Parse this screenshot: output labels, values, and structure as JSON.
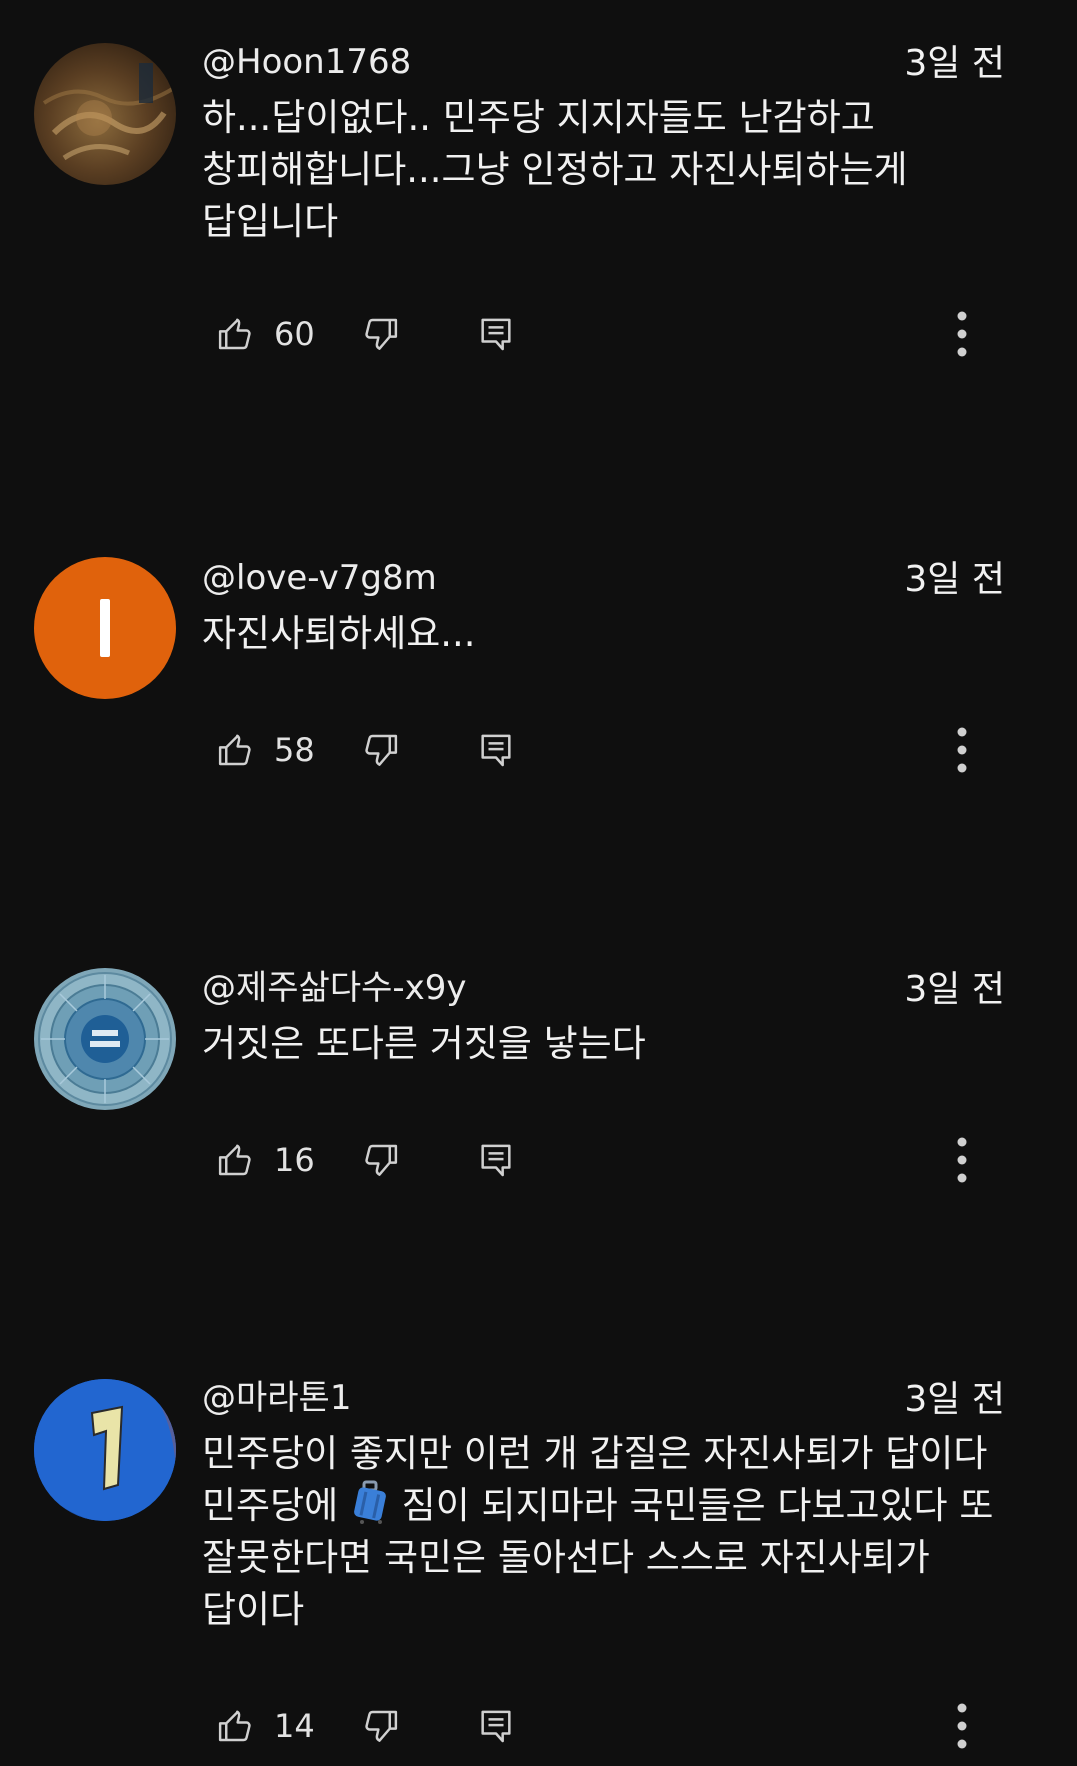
{
  "comments": [
    {
      "author": "@Hoon1768",
      "time": "3일 전",
      "text": "하...답이없다.. 민주당 지지자들도 난감하고 창피해합니다...그냥 인정하고 자진사퇴하는게 답입니다",
      "likes": "60",
      "avatar": "photo-avatar"
    },
    {
      "author": "@love-v7g8m",
      "time": "3일 전",
      "text": "자진사퇴하세요...",
      "likes": "58",
      "avatar": "letter-avatar",
      "avatar_letter": "l",
      "avatar_color": "#e0620c"
    },
    {
      "author": "@제주삶다수-x9y",
      "time": "3일 전",
      "text": "거짓은 또다른 거짓을 낳는다",
      "likes": "16",
      "avatar": "circle-emblem-avatar"
    },
    {
      "author": "@마라톤1",
      "time": "3일 전",
      "text_before_emoji": "민주당이 좋지만 이런 개 갑질은 자진사퇴가 답이다 민주당에 ",
      "emoji": "suitcase",
      "text_after_emoji": " 짐이 되지마라 국민들은 다보고있다 또 잘못한다면 국민은 돌아선다 스스로 자진사퇴가 답이다",
      "likes": "14",
      "avatar": "jersey-avatar"
    }
  ],
  "icons": {
    "like": "thumbs-up-icon",
    "dislike": "thumbs-down-icon",
    "reply": "reply-icon",
    "more": "more-vertical-icon"
  },
  "colors": {
    "background": "#0f0f0f",
    "text": "#f1f1f1",
    "icon": "#d0d0d0"
  }
}
